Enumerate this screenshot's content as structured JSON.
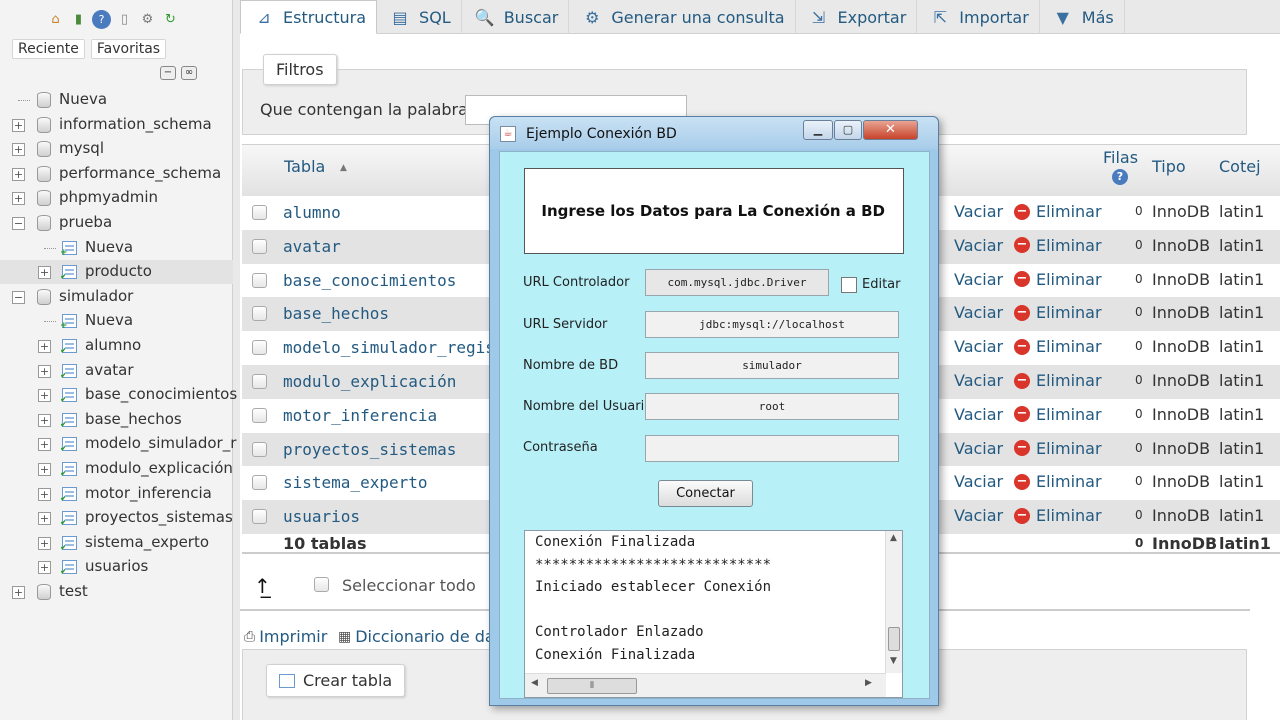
{
  "nav": {
    "tabs": [
      "Reciente",
      "Favoritas"
    ],
    "tree": [
      {
        "label": "Nueva",
        "level": 0,
        "kind": "new"
      },
      {
        "label": "information_schema",
        "level": 0,
        "kind": "db",
        "expander": "+"
      },
      {
        "label": "mysql",
        "level": 0,
        "kind": "db",
        "expander": "+"
      },
      {
        "label": "performance_schema",
        "level": 0,
        "kind": "db",
        "expander": "+"
      },
      {
        "label": "phpmyadmin",
        "level": 0,
        "kind": "db",
        "expander": "+"
      },
      {
        "label": "prueba",
        "level": 0,
        "kind": "db",
        "expander": "−"
      },
      {
        "label": "Nueva",
        "level": 1,
        "kind": "new"
      },
      {
        "label": "producto",
        "level": 1,
        "kind": "table",
        "expander": "+"
      },
      {
        "label": "simulador",
        "level": 0,
        "kind": "db",
        "expander": "−"
      },
      {
        "label": "Nueva",
        "level": 1,
        "kind": "new"
      },
      {
        "label": "alumno",
        "level": 1,
        "kind": "table",
        "expander": "+"
      },
      {
        "label": "avatar",
        "level": 1,
        "kind": "table",
        "expander": "+"
      },
      {
        "label": "base_conocimientos",
        "level": 1,
        "kind": "table",
        "expander": "+"
      },
      {
        "label": "base_hechos",
        "level": 1,
        "kind": "table",
        "expander": "+"
      },
      {
        "label": "modelo_simulador_r",
        "level": 1,
        "kind": "table",
        "expander": "+"
      },
      {
        "label": "modulo_explicación",
        "level": 1,
        "kind": "table",
        "expander": "+"
      },
      {
        "label": "motor_inferencia",
        "level": 1,
        "kind": "table",
        "expander": "+"
      },
      {
        "label": "proyectos_sistemas",
        "level": 1,
        "kind": "table",
        "expander": "+"
      },
      {
        "label": "sistema_experto",
        "level": 1,
        "kind": "table",
        "expander": "+"
      },
      {
        "label": "usuarios",
        "level": 1,
        "kind": "table",
        "expander": "+"
      },
      {
        "label": "test",
        "level": 0,
        "kind": "db",
        "expander": "+"
      }
    ]
  },
  "tabs": [
    {
      "label": "Estructura",
      "icon": "structure-icon",
      "glyph": "⊿",
      "active": true
    },
    {
      "label": "SQL",
      "icon": "sql-icon",
      "glyph": "▤"
    },
    {
      "label": "Buscar",
      "icon": "search-icon",
      "glyph": "🔍"
    },
    {
      "label": "Generar una consulta",
      "icon": "query-icon",
      "glyph": "⚙"
    },
    {
      "label": "Exportar",
      "icon": "export-icon",
      "glyph": "⇲"
    },
    {
      "label": "Importar",
      "icon": "import-icon",
      "glyph": "⇱"
    },
    {
      "label": "Más",
      "icon": "more-icon",
      "glyph": "▼"
    }
  ],
  "filters": {
    "legend": "Filtros",
    "label": "Que contengan la palabra:",
    "value": ""
  },
  "table": {
    "headers": {
      "name": "Tabla",
      "rows": "Filas",
      "type": "Tipo",
      "collation": "Cotej"
    },
    "rows": [
      {
        "name": "alumno",
        "rows": "0",
        "type": "InnoDB",
        "collation": "latin1"
      },
      {
        "name": "avatar",
        "rows": "0",
        "type": "InnoDB",
        "collation": "latin1"
      },
      {
        "name": "base_conocimientos",
        "rows": "0",
        "type": "InnoDB",
        "collation": "latin1"
      },
      {
        "name": "base_hechos",
        "rows": "0",
        "type": "InnoDB",
        "collation": "latin1"
      },
      {
        "name": "modelo_simulador_registr",
        "rows": "0",
        "type": "InnoDB",
        "collation": "latin1"
      },
      {
        "name": "modulo_explicación",
        "rows": "0",
        "type": "InnoDB",
        "collation": "latin1"
      },
      {
        "name": "motor_inferencia",
        "rows": "0",
        "type": "InnoDB",
        "collation": "latin1"
      },
      {
        "name": "proyectos_sistemas",
        "rows": "0",
        "type": "InnoDB",
        "collation": "latin1"
      },
      {
        "name": "sistema_experto",
        "rows": "0",
        "type": "InnoDB",
        "collation": "latin1"
      },
      {
        "name": "usuarios",
        "rows": "0",
        "type": "InnoDB",
        "collation": "latin1"
      }
    ],
    "actions": {
      "empty": "Vaciar",
      "drop": "Eliminar"
    },
    "footer": {
      "name": "10 tablas",
      "rows": "0",
      "type": "InnoDB",
      "collation": "latin1"
    }
  },
  "select_all": "Seleccionar todo",
  "links": {
    "print": "Imprimir",
    "dictionary": "Diccionario de da"
  },
  "create_table": "Crear tabla",
  "dialog": {
    "title": "Ejemplo Conexión BD",
    "heading": "Ingrese los Datos para La Conexión a BD",
    "fields": {
      "driver_label": "URL Controlador",
      "driver_value": "com.mysql.jdbc.Driver",
      "edit_label": "Editar",
      "server_label": "URL Servidor",
      "server_value": "jdbc:mysql://localhost",
      "db_label": "Nombre de BD",
      "db_value": "simulador",
      "user_label": "Nombre del Usuario",
      "user_value": "root",
      "password_label": "Contraseña",
      "password_value": ""
    },
    "connect_label": "Conectar",
    "log": [
      "Conexión Finalizada",
      "****************************",
      "Iniciado establecer Conexión",
      "",
      "Controlador Enlazado",
      "Conexión Finalizada"
    ]
  }
}
